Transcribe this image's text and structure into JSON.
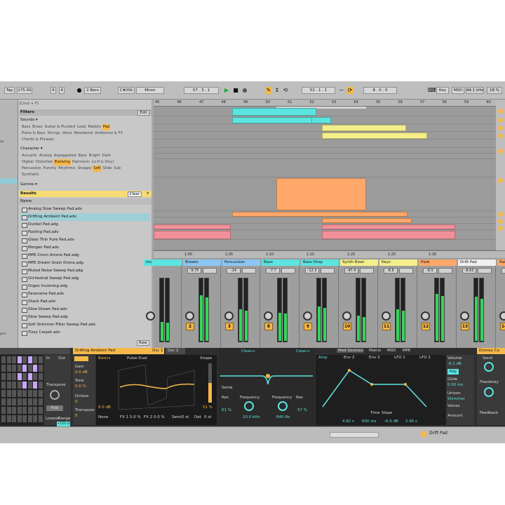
{
  "toolbar": {
    "tap": "Tap",
    "tempo": "175.00",
    "sig_num": "4",
    "sig_den": "4",
    "quant": "2 Bars",
    "key": "C#/Db",
    "scale": "Minor",
    "pos": "57 .  3 .  1",
    "loop_start": "53 .  1 .  1",
    "loop_len": "8 .  0 .  0",
    "key_btn": "Key",
    "midi": "MIDI",
    "sr": "44.1 kHz",
    "cpu": "18 %"
  },
  "browser": {
    "search_hint": "(Cmd + F)",
    "filters": "Filters",
    "edit": "Edit",
    "sounds_label": "Sounds ▾",
    "sounds": [
      {
        "t": "Bass",
        "s": false
      },
      {
        "t": "Brass",
        "s": false
      },
      {
        "t": "Guitar & Plucked",
        "s": false
      },
      {
        "t": "Lead",
        "s": false
      },
      {
        "t": "Mallets",
        "s": false
      },
      {
        "t": "Pad",
        "s": true
      },
      {
        "t": "Piano & Keys",
        "s": false
      },
      {
        "t": "Strings",
        "s": false
      },
      {
        "t": "Voice",
        "s": false
      },
      {
        "t": "Woodwind",
        "s": false
      },
      {
        "t": "Ambience & FX",
        "s": false
      },
      {
        "t": "Chords & Phrases",
        "s": false
      }
    ],
    "character_label": "Character ▾",
    "character": [
      {
        "t": "Acoustic",
        "s": false
      },
      {
        "t": "Analog",
        "s": false
      },
      {
        "t": "Arpeggiated",
        "s": false
      },
      {
        "t": "Bass",
        "s": false
      },
      {
        "t": "Bright",
        "s": false
      },
      {
        "t": "Dark",
        "s": false
      },
      {
        "t": "Digital",
        "s": false
      },
      {
        "t": "Distorted",
        "s": false
      },
      {
        "t": "Evolving",
        "s": true
      },
      {
        "t": "Harmonic",
        "s": false
      },
      {
        "t": "Lo-fi & Vinyl",
        "s": false
      },
      {
        "t": "Percussive",
        "s": false
      },
      {
        "t": "Punchy",
        "s": false
      },
      {
        "t": "Rhythmic",
        "s": false
      },
      {
        "t": "Snappy",
        "s": false
      },
      {
        "t": "Soft",
        "s": true
      },
      {
        "t": "Slide",
        "s": false
      },
      {
        "t": "Sub",
        "s": false
      },
      {
        "t": "Synthetic",
        "s": false
      }
    ],
    "genres_label": "Genres ▾",
    "results": "Results",
    "clear": "Clear",
    "name_col": "Name",
    "files": [
      "Analog Slow Sweep Pad.adv",
      "Drifting Ambient Pad.adv",
      "Dunkel Pad.adg",
      "Fizzling Pad.adv",
      "Glass Thin Pure Pad.adv",
      "Morgen Pad.adv",
      "MPE Cinnn Amore Pad.adg",
      "MPE Dream Grain Drone.adg",
      "Muted Noise Sweep Pad.adg",
      "Orchestral Sweep Pad.adg",
      "Organ Incoming.adg",
      "Panorama Pad.adv",
      "Shark Pad.adv",
      "Slow Drown Pad.adv",
      "Slow Sweep Pad.adg",
      "Soft Shimmer Filter Sweep Pad.adv",
      "Tizzy Carpet.adv"
    ],
    "raw": "Raw",
    "sidebar": [
      "ds",
      "",
      "",
      "",
      "",
      "",
      "",
      "",
      "",
      "",
      "",
      "ject"
    ]
  },
  "ruler": [
    "45",
    "46",
    "47",
    "48",
    "49",
    "50",
    "51",
    "52",
    "53",
    "54",
    "55",
    "56",
    "57",
    "58",
    "59",
    "60",
    "61",
    "62",
    "63",
    "64"
  ],
  "timebar": [
    "1:00",
    "1:05",
    "1:10",
    "1:15",
    "1:20",
    "1:25",
    "1:30"
  ],
  "tracks": [
    {
      "name": "ms",
      "val": "",
      "num": ""
    },
    {
      "name": "Breaks",
      "val": "-9.75",
      "num": "2"
    },
    {
      "name": "Percussion",
      "val": "-14",
      "num": "3"
    },
    {
      "name": "Bass",
      "val": "-7.7",
      "num": "8"
    },
    {
      "name": "Bass Drop",
      "val": "-12.3",
      "num": "9"
    },
    {
      "name": "Synth Riser",
      "val": "-47.4",
      "num": "10"
    },
    {
      "name": "Keys",
      "val": "-8.6",
      "num": "11"
    },
    {
      "name": "Pads",
      "val": "-8.5",
      "num": "12"
    },
    {
      "name": "Drift Pad",
      "val": "-8.63",
      "num": "13"
    },
    {
      "name": "Rain R",
      "val": "-3.3",
      "num": "14"
    }
  ],
  "device": {
    "title": "Drifting Ambient Pad",
    "osc1": "Osc 1",
    "osc2": "Osc 2",
    "basics": "Basics",
    "wave": "Pulse Dual",
    "shape": "Shape",
    "gain": "Gain",
    "gain_val": "0.0 dB",
    "tone": "Tone",
    "tone_val": "0.0 %",
    "octave": "Octave",
    "octave_val": "0",
    "transpose": "Transpose",
    "transpose_val": "0",
    "fx": "FX 1",
    "fx1": "5.0 %",
    "fx2_l": "FX 2",
    "fx2": "0.0 %",
    "semi": "Semi",
    "semi_val": "0 st",
    "det": "Det",
    "det_val": "0 st",
    "pct": "51 %",
    "filt1": "Clean+",
    "filt2": "Clean+",
    "serial": "Serial",
    "res": "Res",
    "res_val": "61 %",
    "freq": "Frequency",
    "freq_val": "10.0 kHz",
    "res2": "Res",
    "freq2_val": "640 Hz",
    "res2_val": "57 %",
    "in": "In",
    "out": "Out",
    "lowest": "Lowest",
    "range": "Range",
    "range_val": "+120 st",
    "fold": "Fold",
    "none": "None",
    "mod_tabs": [
      "Mod Sources",
      "Matrix",
      "MIDI",
      "MPE"
    ],
    "env": [
      "Amp",
      "Env 2",
      "Env 3",
      "LFO 1",
      "LFO 2"
    ],
    "time": "Time",
    "slope": "Slope",
    "adsr": [
      "4.82 s",
      "600 ms",
      "-6.0 dB",
      "2.90 s"
    ],
    "volume": "Volume",
    "volume_val": "-6.2 dB",
    "poly": "Poly",
    "glide": "Glide",
    "glide_val": "0.00 ms",
    "unison": "Unison",
    "unison_val": "Shimmer",
    "voices": "Voices",
    "amount": "Amount",
    "drone": "Droney Ca",
    "send": "Send",
    "freedelay": "Freedelay",
    "feedback": "Feedback"
  },
  "status": {
    "track": "Drift Pad"
  },
  "colors": {
    "cyan": "#5ce4e0",
    "yellow": "#f4ef8a",
    "orange": "#ffa86a",
    "pink": "#f2909a",
    "accent": "#f7b84a"
  }
}
